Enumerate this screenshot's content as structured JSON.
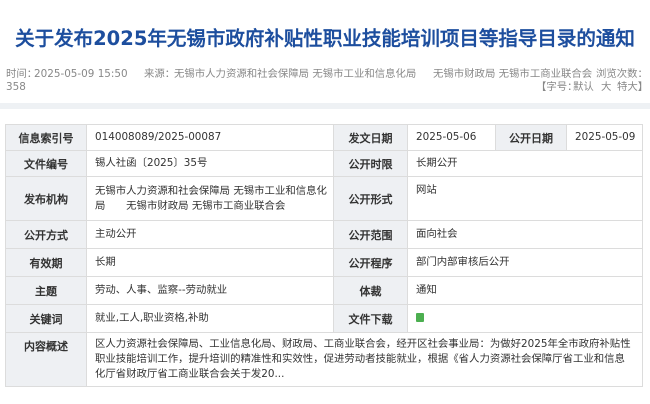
{
  "page_title": "关于发布2025年无锡市政府补贴性职业技能培训项目等指导目录的通知",
  "meta": {
    "time_label": "时间：",
    "time_value": "2025-05-09 15:50",
    "source_label": "来源：",
    "source_value": "无锡市人力资源和社会保障局 无锡市工业和信息化局",
    "source_value2": "无锡市财政局 无锡市工商业联合会",
    "views_label": "浏览次数：",
    "views_value": "358",
    "font_size_label": "【字号：",
    "font_default": "默认",
    "font_large": "大",
    "font_xlarge": "特大】"
  },
  "info": {
    "index_no_label": "信息索引号",
    "index_no": "014008089/2025-00087",
    "issue_date_label": "发文日期",
    "issue_date": "2025-05-06",
    "publish_date_label": "公开日期",
    "publish_date": "2025-05-09",
    "doc_no_label": "文件编号",
    "doc_no": "锡人社函〔2025〕35号",
    "disclosure_period_label": "公开时限",
    "disclosure_period": "长期公开",
    "agency_label": "发布机构",
    "agency": "无锡市人力资源和社会保障局 无锡市工业和信息化局　　无锡市财政局 无锡市工商业联合会",
    "disclosure_form_label": "公开形式",
    "disclosure_form": "网站",
    "disclosure_method_label": "公开方式",
    "disclosure_method": "主动公开",
    "disclosure_scope_label": "公开范围",
    "disclosure_scope": "面向社会",
    "validity_label": "有效期",
    "validity": "长期",
    "procedure_label": "公开程序",
    "procedure": "部门内部审核后公开",
    "topic_label": "主题",
    "topic": "劳动、人事、监察--劳动就业",
    "genre_label": "体裁",
    "genre": "通知",
    "keywords_label": "关键词",
    "keywords": "就业,工人,职业资格,补助",
    "download_label": "文件下载",
    "summary_label": "内容概述",
    "summary": "区人力资源社会保障局、工业信息化局、财政局、工商业联合会，经开区社会事业局：为做好2025年全市政府补贴性职业技能培训工作，提升培训的精准性和实效性，促进劳动者技能就业，根据《省人力资源社会保障厅省工业和信息化厅省财政厅省工商业联合会关于发20..."
  }
}
